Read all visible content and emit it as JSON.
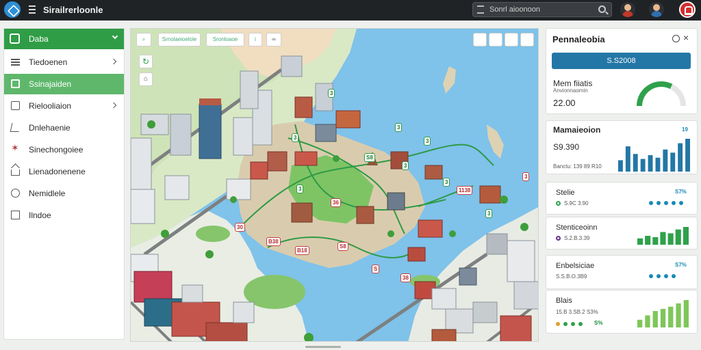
{
  "app": {
    "title": "Sirailrerloonle"
  },
  "search": {
    "text": "Sonrl aioonoon"
  },
  "sidebar": {
    "header": "Daba",
    "items": [
      {
        "label": "Tiedoenen",
        "icon": "list-icon",
        "chevron": true,
        "active": false
      },
      {
        "label": "Ssinajaiden",
        "icon": "chart-icon",
        "chevron": false,
        "active": true
      },
      {
        "label": "Rielooliaion",
        "icon": "document-icon",
        "chevron": true,
        "active": false
      },
      {
        "label": "Dnlehaenie",
        "icon": "pen-icon",
        "chevron": false,
        "active": false
      },
      {
        "label": "Sinechongoiee",
        "icon": "star-icon",
        "chevron": false,
        "active": false
      },
      {
        "label": "Lienadonenene",
        "icon": "home-icon",
        "chevron": false,
        "active": false
      },
      {
        "label": "Nemidlele",
        "icon": "circle-icon",
        "chevron": false,
        "active": false
      },
      {
        "label": "Ilndoe",
        "icon": "square-icon",
        "chevron": false,
        "active": false
      }
    ]
  },
  "map": {
    "toolbar": [
      "Srnolaeioelole",
      "Sronloaoe",
      "i"
    ],
    "pins_green": [
      "3",
      "3",
      "3",
      "3",
      "3",
      "3",
      "S8",
      "3",
      "3",
      "3"
    ],
    "pins_red": [
      "3",
      "1138",
      "36",
      "30",
      "B38",
      "S8",
      "B18",
      "S",
      "38"
    ]
  },
  "right_panel": {
    "card1": {
      "title": "Pennaleobia",
      "button": "S.S2008",
      "metric": "Mem fiiatis",
      "sub": "Anvionnaomin",
      "value": "22.00",
      "gauge_fraction": 0.65,
      "gauge_color": "#2fa14b"
    },
    "card2": {
      "title": "Mamaieoion",
      "corner": "19",
      "value": "S9.390",
      "sub": "Banctu: 139 89 R10",
      "bars": [
        18,
        40,
        28,
        20,
        26,
        22,
        35,
        30,
        45,
        52
      ]
    },
    "rows": [
      {
        "title": "Stelie",
        "pct": "S7%",
        "pct_color": "#1a8ab5",
        "sub": "S.9C 3.90",
        "dot_color": "#2fa14b",
        "dots": [
          "#1a8ab5",
          "#1a8ab5",
          "#1a8ab5",
          "#1a8ab5",
          "#1a8ab5"
        ]
      },
      {
        "title": "Stenticeoinn",
        "pct": "",
        "pct_color": "#1a8ab5",
        "sub": "S.2.B.3.39",
        "dot_color": "#6b2f8a",
        "bars": [
          10,
          14,
          12,
          20,
          18,
          24,
          28
        ]
      },
      {
        "title": "Enbelsiciae",
        "pct": "S7%",
        "pct_color": "#1a8ab5",
        "sub": "S.S.B.O.3B9",
        "dot_color": "",
        "dots": [
          "#1a8ab5",
          "#1a8ab5",
          "#1a8ab5",
          "#1a8ab5"
        ]
      },
      {
        "title": "Blais",
        "pct": "",
        "pct_color": "#c94040",
        "sub": "15.B 3.SB.2 S3%",
        "dot_color": "",
        "dots": [
          "#e0a030",
          "#2fa14b",
          "#2fa14b",
          "#2fa14b"
        ],
        "dots_pct": "S%",
        "bars": [
          14,
          22,
          30,
          34,
          38,
          44,
          50
        ]
      }
    ]
  }
}
